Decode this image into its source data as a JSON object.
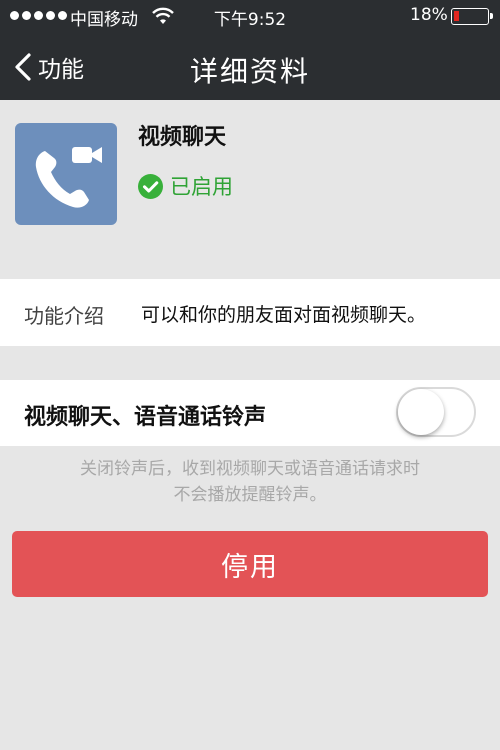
{
  "status_bar": {
    "carrier": "中国移动",
    "time": "下午9:52",
    "battery": "18%",
    "battery_level": 0.18,
    "signal_icon": "signal-dots-icon",
    "wifi_icon": "wifi-icon",
    "battery_icon": "battery-icon"
  },
  "nav": {
    "back_label": "功能",
    "back_icon": "chevron-left-icon",
    "title": "详细资料"
  },
  "app": {
    "name": "视频聊天",
    "icon": "video-call-icon",
    "icon_color": "#6d8fbc",
    "status": "已启用",
    "status_icon": "checkmark-icon",
    "status_color": "#2fa335"
  },
  "intro": {
    "label": "功能介绍",
    "text": "可以和你的朋友面对面视频聊天。"
  },
  "ringtone": {
    "label": "视频聊天、语音通话铃声",
    "enabled": false,
    "hint_line1": "关闭铃声后，收到视频聊天或语音通话请求时",
    "hint_line2": "不会播放提醒铃声。"
  },
  "actions": {
    "disable_label": "停用",
    "disable_color": "#e35356"
  }
}
